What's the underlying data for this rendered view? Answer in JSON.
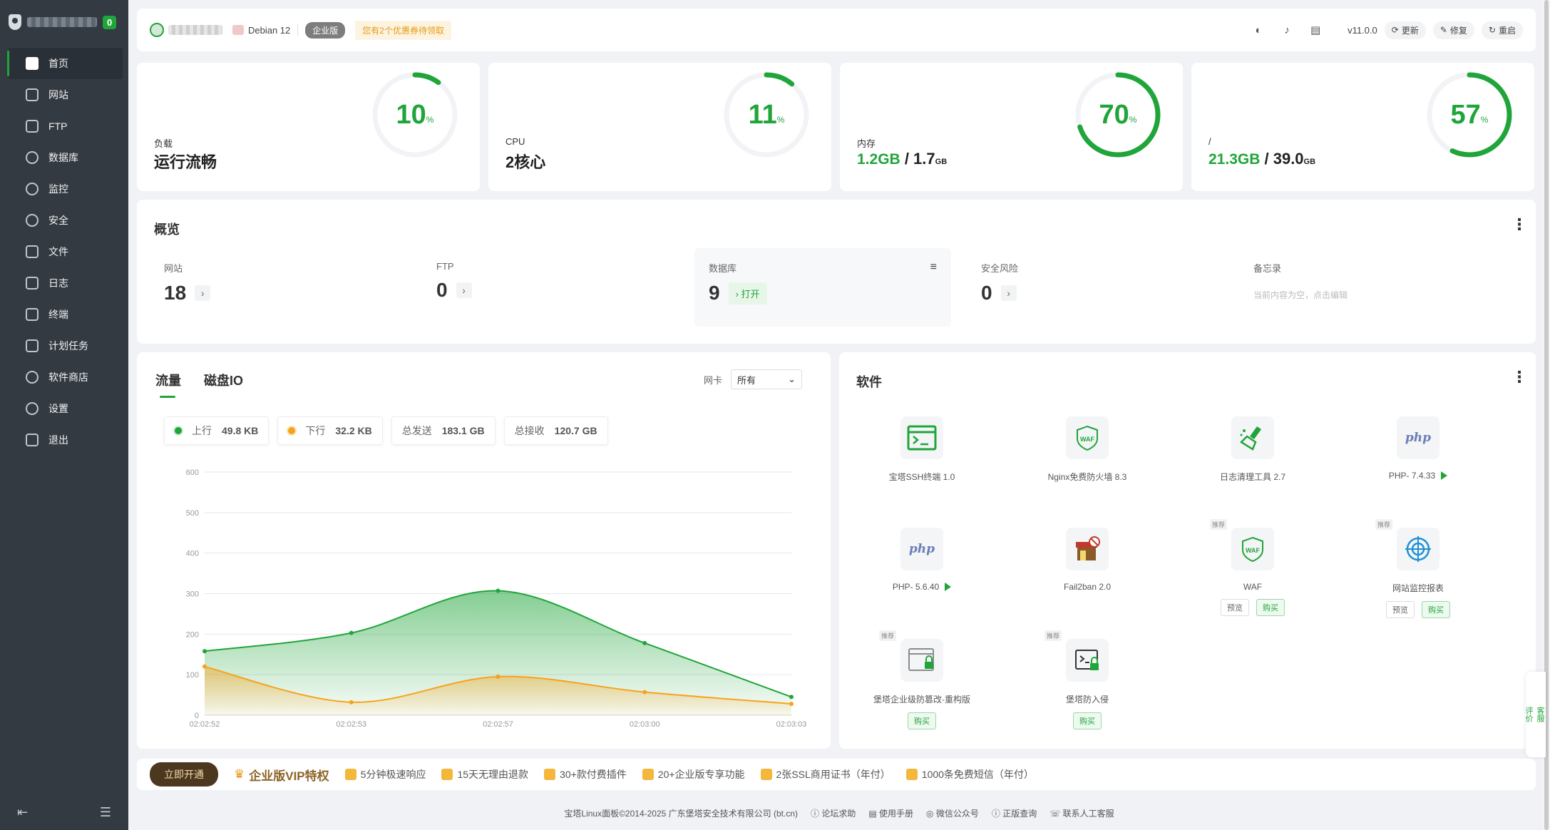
{
  "sidebar": {
    "badge": "0",
    "items": [
      {
        "label": "首页",
        "icon": "home-icon"
      },
      {
        "label": "网站",
        "icon": "website-icon"
      },
      {
        "label": "FTP",
        "icon": "ftp-icon"
      },
      {
        "label": "数据库",
        "icon": "database-icon"
      },
      {
        "label": "监控",
        "icon": "monitor-icon"
      },
      {
        "label": "安全",
        "icon": "shield-icon"
      },
      {
        "label": "文件",
        "icon": "folder-icon"
      },
      {
        "label": "日志",
        "icon": "log-icon"
      },
      {
        "label": "终端",
        "icon": "terminal-icon"
      },
      {
        "label": "计划任务",
        "icon": "calendar-icon"
      },
      {
        "label": "软件商店",
        "icon": "store-icon"
      },
      {
        "label": "设置",
        "icon": "gear-icon"
      },
      {
        "label": "退出",
        "icon": "exit-icon"
      }
    ]
  },
  "topbar": {
    "os": "Debian 12",
    "edition": "企业版",
    "coupon": "您有2个优惠券待领取",
    "version": "v11.0.0",
    "update": "更新",
    "repair": "修复",
    "restart": "重启"
  },
  "stats": [
    {
      "label": "负载",
      "value": "运行流畅",
      "percent": "10",
      "unit": "%"
    },
    {
      "label": "CPU",
      "value": "2核心",
      "percent": "11",
      "unit": "%"
    },
    {
      "label": "内存",
      "used": "1.2",
      "used_unit": "GB",
      "total": "1.7",
      "total_unit": "GB",
      "percent": "70",
      "unit": "%"
    },
    {
      "label": "/",
      "used": "21.3",
      "used_unit": "GB",
      "total": "39.0",
      "total_unit": "GB",
      "percent": "57",
      "unit": "%"
    }
  ],
  "overview": {
    "title": "概览",
    "items": [
      {
        "label": "网站",
        "value": "18"
      },
      {
        "label": "FTP",
        "value": "0"
      },
      {
        "label": "数据库",
        "value": "9",
        "action": "打开"
      },
      {
        "label": "安全风险",
        "value": "0"
      },
      {
        "label": "备忘录",
        "placeholder": "当前内容为空，点击编辑"
      }
    ]
  },
  "traffic": {
    "tabs": [
      "流量",
      "磁盘IO"
    ],
    "nic_label": "网卡",
    "nic_value": "所有",
    "legend": [
      {
        "label": "上行",
        "value": "49.8 KB",
        "color": "#20a53a"
      },
      {
        "label": "下行",
        "value": "32.2 KB",
        "color": "#f7a21b"
      },
      {
        "label": "总发送",
        "value": "183.1 GB"
      },
      {
        "label": "总接收",
        "value": "120.7 GB"
      }
    ]
  },
  "chart_data": {
    "type": "area",
    "categories": [
      "02:02:52",
      "02:02:53",
      "02:02:57",
      "02:03:00",
      "02:03:03"
    ],
    "series": [
      {
        "name": "上行",
        "values": [
          158,
          203,
          307,
          178,
          45
        ],
        "color": "#20a53a"
      },
      {
        "name": "下行",
        "values": [
          120,
          32,
          95,
          57,
          28
        ],
        "color": "#f7a21b"
      }
    ],
    "yticks": [
      0,
      100,
      200,
      300,
      400,
      500,
      600
    ],
    "ylim": [
      0,
      600
    ],
    "grid": true
  },
  "software": {
    "title": "软件",
    "items": [
      {
        "name": "宝塔SSH终端 1.0",
        "icon": "terminal-icon"
      },
      {
        "name": "Nginx免费防火墙 8.3",
        "icon": "waf-shield-icon"
      },
      {
        "name": "日志清理工具 2.7",
        "icon": "broom-icon"
      },
      {
        "name": "PHP- 7.4.33",
        "icon": "php-icon",
        "play": true
      },
      {
        "name": "PHP- 5.6.40",
        "icon": "php-icon",
        "play": true
      },
      {
        "name": "Fail2ban 2.0",
        "icon": "fail2ban-icon"
      },
      {
        "name": "WAF",
        "icon": "waf-shield-icon",
        "tag": "推荐",
        "preview": "预览",
        "buy": "购买"
      },
      {
        "name": "网站监控报表",
        "icon": "target-icon",
        "tag": "推荐",
        "preview": "预览",
        "buy": "购买"
      },
      {
        "name": "堡塔企业级防篡改-重构版",
        "icon": "lock-file-icon",
        "tag": "推荐",
        "buy": "购买"
      },
      {
        "name": "堡塔防入侵",
        "icon": "lock-terminal-icon",
        "tag": "推荐",
        "buy": "购买"
      }
    ]
  },
  "vip": {
    "button": "立即开通",
    "title": "企业版VIP特权",
    "features": [
      "5分钟极速响应",
      "15天无理由退款",
      "30+款付费插件",
      "20+企业版专享功能",
      "2张SSL商用证书（年付）",
      "1000条免费短信（年付）"
    ]
  },
  "footer": {
    "copyright": "宝塔Linux面板©2014-2025 广东堡塔安全技术有限公司 (bt.cn)",
    "links": [
      "论坛求助",
      "使用手册",
      "微信公众号",
      "正版查询",
      "联系人工客服"
    ]
  },
  "float": {
    "service": "客服",
    "review": "评价"
  }
}
